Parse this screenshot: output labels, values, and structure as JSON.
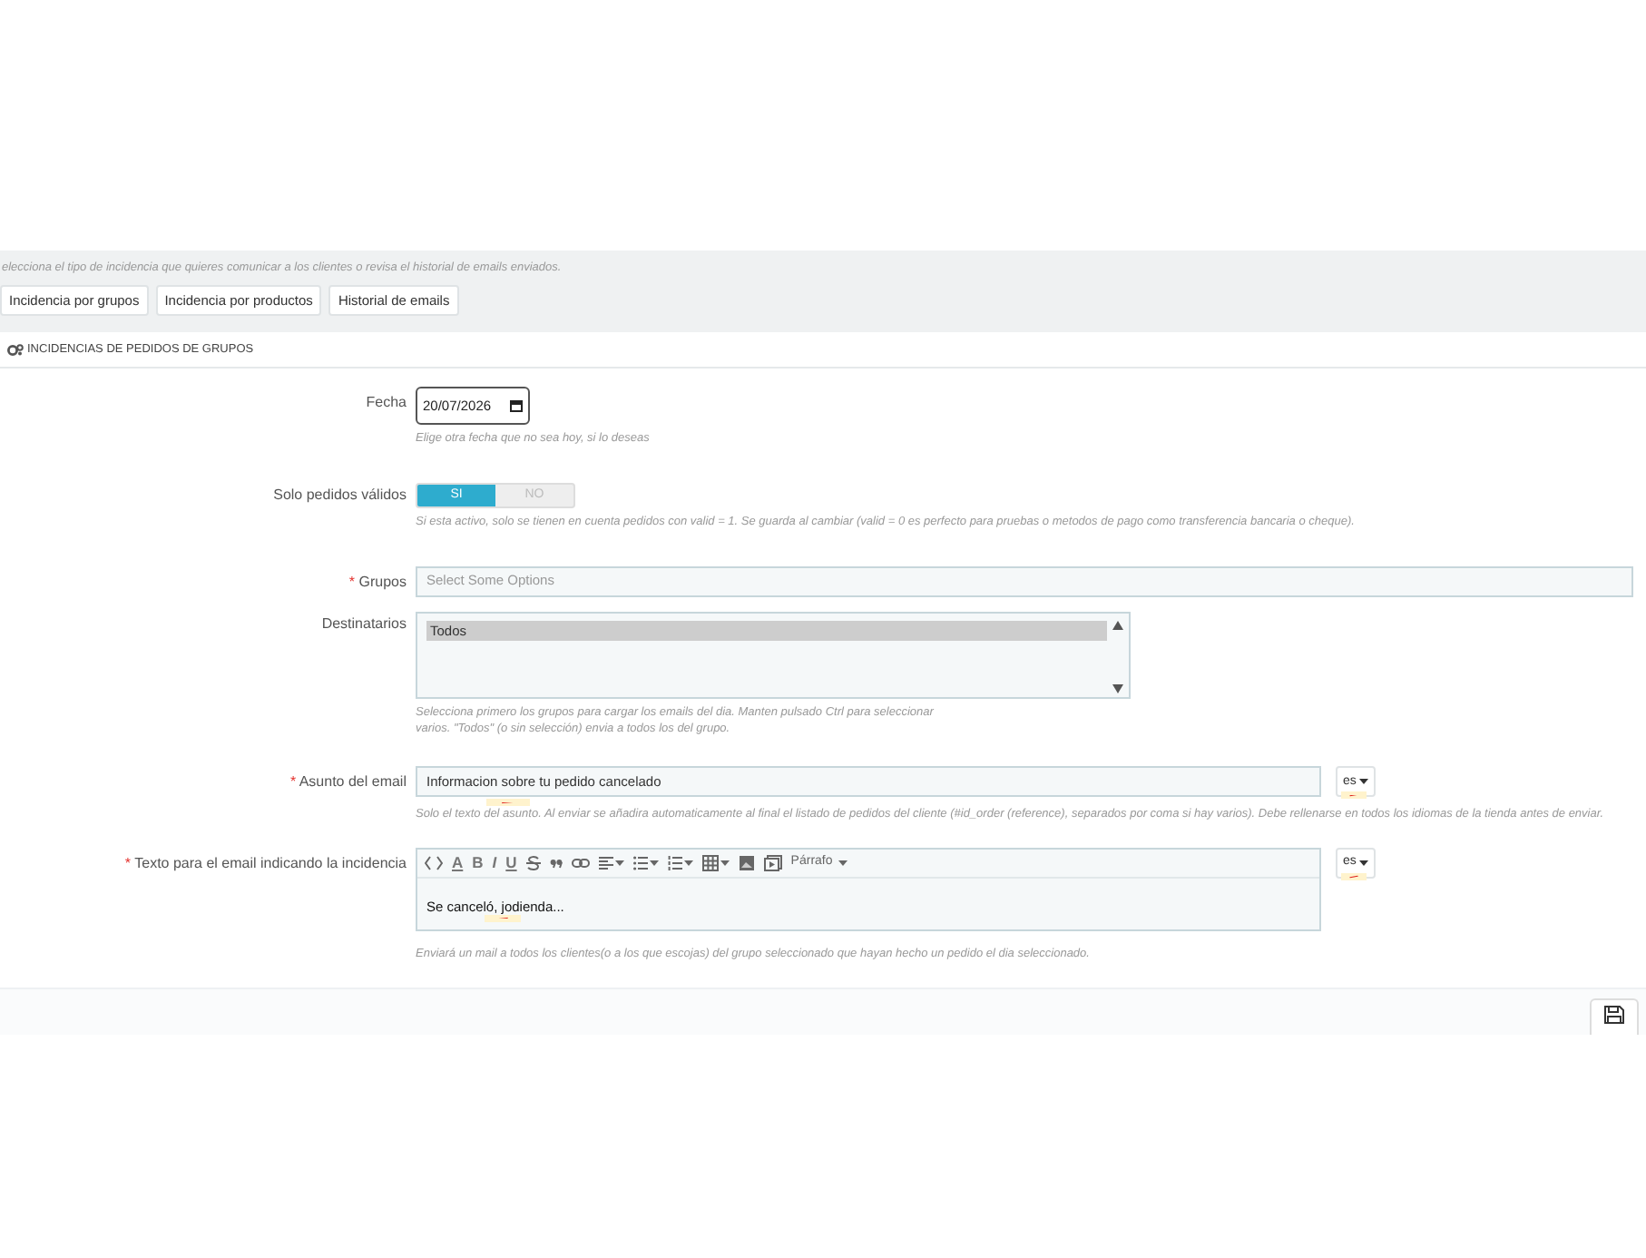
{
  "intro": "elecciona el tipo de incidencia que quieres comunicar a los clientes o revisa el historial de emails enviados.",
  "tabs": [
    "Incidencia por grupos",
    "Incidencia por productos",
    "Historial de emails"
  ],
  "panel_title": "INCIDENCIAS DE PEDIDOS DE GRUPOS",
  "fecha": {
    "label": "Fecha",
    "value": "20/07/2026",
    "help": "Elige otra fecha que no sea hoy, si lo deseas"
  },
  "solo_validos": {
    "label": "Solo pedidos válidos",
    "options": [
      "SI",
      "NO"
    ],
    "on": true,
    "help": "Si esta activo, solo se tienen en cuenta pedidos con valid = 1. Se guarda al cambiar (valid = 0 es perfecto para pruebas o metodos de pago como transferencia bancaria o cheque)."
  },
  "grupos": {
    "label": "Grupos",
    "required_mark": "*",
    "placeholder": "Select Some Options"
  },
  "destinatarios": {
    "label": "Destinatarios",
    "options": [
      {
        "label": "Todos",
        "selected": true
      }
    ],
    "help": "Selecciona primero los grupos para cargar los emails del dia. Manten pulsado Ctrl para seleccionar varios. \"Todos\" (o sin selección) envia a todos los del grupo."
  },
  "asunto": {
    "label": "Asunto del email",
    "required_mark": "*",
    "value": "Informacion sobre tu pedido cancelado",
    "language": "es",
    "help": "Solo el texto del asunto. Al enviar se añadira automaticamente al final el listado de pedidos del cliente (#id_order (reference), separados por coma si hay varios). Debe rellenarse en todos los idiomas de la tienda antes de enviar."
  },
  "texto": {
    "label": "Texto para el email indicando la incidencia",
    "required_mark": "*",
    "toolbar_letters": [
      "A",
      "B",
      "I",
      "U"
    ],
    "format_menu": "Párrafo",
    "content": "Se canceló, jodienda...",
    "language": "es",
    "help": "Enviará un mail a todos los clientes(o a los que escojas) del grupo seleccionado que hayan hecho un pedido el dia seleccionado."
  }
}
